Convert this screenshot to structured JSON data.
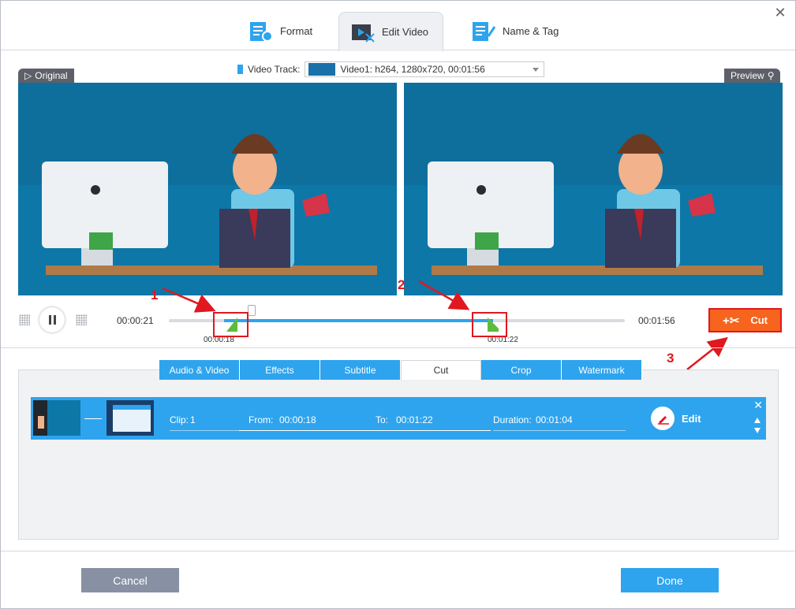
{
  "tabs": [
    {
      "label": "Format",
      "icon": "format-icon"
    },
    {
      "label": "Edit Video",
      "icon": "edit-video-icon",
      "active": true
    },
    {
      "label": "Name & Tag",
      "icon": "name-tag-icon"
    }
  ],
  "track": {
    "label": "Video Track:",
    "value": "Video1: h264, 1280x720, 00:01:56"
  },
  "panels": {
    "original_label": "Original",
    "preview_label": "Preview"
  },
  "timeline": {
    "current_time": "00:00:21",
    "total_time": "00:01:56",
    "start_marker": "00:00:18",
    "end_marker": "00:01:22",
    "cut_label": "Cut"
  },
  "annotations": {
    "n1": "1",
    "n2": "2",
    "n3": "3"
  },
  "subtabs": [
    "Audio & Video",
    "Effects",
    "Subtitle",
    "Cut",
    "Crop",
    "Watermark"
  ],
  "active_subtab": "Cut",
  "clip": {
    "clip_label": "Clip:",
    "clip_num": "1",
    "from_label": "From:",
    "from_value": "00:00:18",
    "to_label": "To:",
    "to_value": "00:01:22",
    "duration_label": "Duration:",
    "duration_value": "00:01:04",
    "edit_label": "Edit"
  },
  "buttons": {
    "cancel": "Cancel",
    "done": "Done"
  },
  "colors": {
    "accent": "#2ea4ee",
    "cut": "#f6641e",
    "annotation": "#e0181f",
    "cancel": "#8791a3"
  }
}
